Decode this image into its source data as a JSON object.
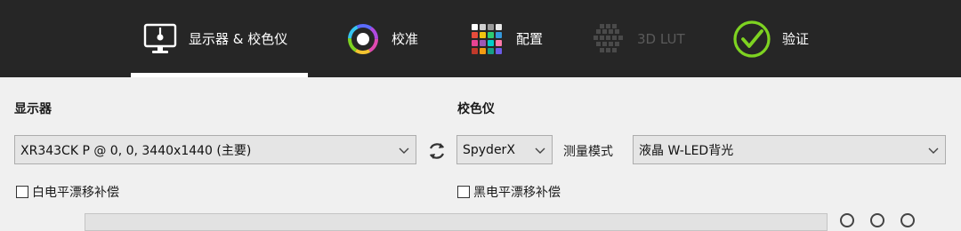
{
  "nav": {
    "tabs": [
      {
        "label": "显示器 & 校色仪",
        "icon": "display-icon",
        "active": true,
        "enabled": true
      },
      {
        "label": "校准",
        "icon": "color-wheel-icon",
        "active": false,
        "enabled": true
      },
      {
        "label": "配置",
        "icon": "color-grid-icon",
        "active": false,
        "enabled": true
      },
      {
        "label": "3D LUT",
        "icon": "lut-cube-icon",
        "active": false,
        "enabled": false
      },
      {
        "label": "验证",
        "icon": "check-circle-icon",
        "active": false,
        "enabled": true
      }
    ]
  },
  "display_section": {
    "title": "显示器",
    "selected_display": "XR343CK P @ 0, 0, 3440x1440 (主要)",
    "white_drift_label": "白电平漂移补偿",
    "white_drift_checked": false
  },
  "colorimeter_section": {
    "title": "校色仪",
    "selected_instrument": "SpyderX",
    "mode_label": "测量模式",
    "selected_mode": "液晶 W-LED背光",
    "black_drift_label": "黑电平漂移补偿",
    "black_drift_checked": false
  },
  "colors": {
    "topbar": "#262626",
    "accent_green": "#7ed321",
    "active_underline": "#ffffff"
  }
}
